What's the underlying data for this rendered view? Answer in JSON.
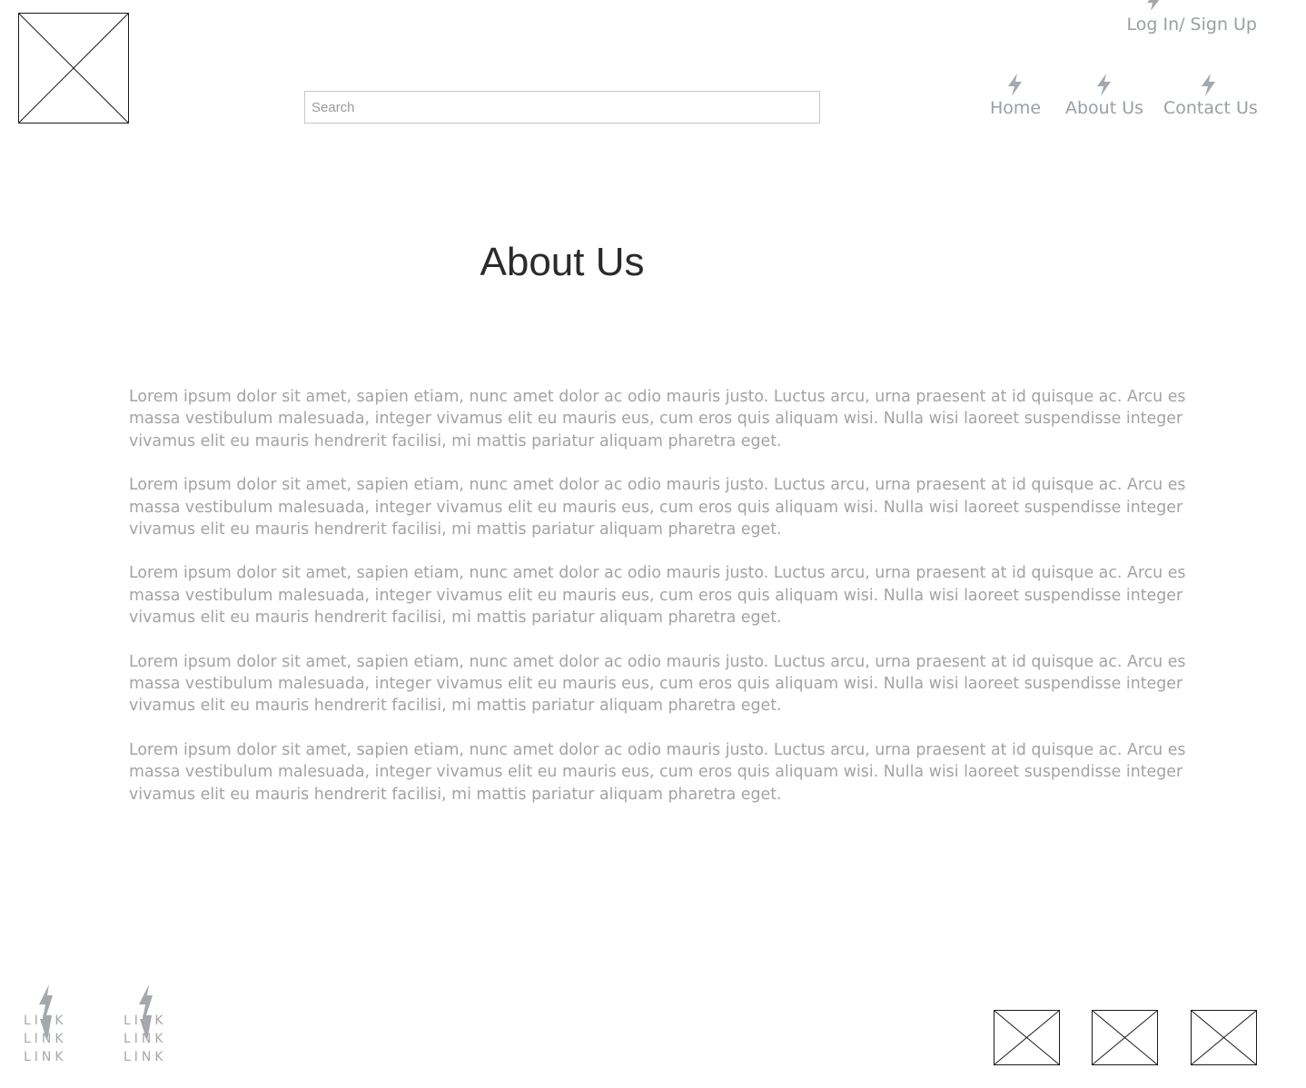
{
  "header": {
    "logo_icon": "image-placeholder-icon",
    "auth_link": "Log In/ Sign Up",
    "search": {
      "placeholder": "Search",
      "value": ""
    },
    "nav": [
      {
        "label": "Home",
        "icon": "bolt-icon"
      },
      {
        "label": "About Us",
        "icon": "bolt-icon"
      },
      {
        "label": "Contact Us",
        "icon": "bolt-icon"
      }
    ]
  },
  "main": {
    "title": "About Us",
    "paragraphs": [
      "Lorem ipsum dolor sit amet, sapien etiam, nunc amet dolor ac odio mauris justo. Luctus arcu, urna praesent at id quisque ac. Arcu es massa vestibulum malesuada, integer vivamus elit eu mauris eus, cum eros quis aliquam wisi. Nulla wisi laoreet suspendisse integer vivamus elit eu mauris hendrerit facilisi, mi mattis pariatur aliquam pharetra eget.",
      "Lorem ipsum dolor sit amet, sapien etiam, nunc amet dolor ac odio mauris justo. Luctus arcu, urna praesent at id quisque ac. Arcu es massa vestibulum malesuada, integer vivamus elit eu mauris eus, cum eros quis aliquam wisi. Nulla wisi laoreet suspendisse integer vivamus elit eu mauris hendrerit facilisi, mi mattis pariatur aliquam pharetra eget.",
      "Lorem ipsum dolor sit amet, sapien etiam, nunc amet dolor ac odio mauris justo. Luctus arcu, urna praesent at id quisque ac. Arcu es massa vestibulum malesuada, integer vivamus elit eu mauris eus, cum eros quis aliquam wisi. Nulla wisi laoreet suspendisse integer vivamus elit eu mauris hendrerit facilisi, mi mattis pariatur aliquam pharetra eget.",
      "Lorem ipsum dolor sit amet, sapien etiam, nunc amet dolor ac odio mauris justo. Luctus arcu, urna praesent at id quisque ac. Arcu es massa vestibulum malesuada, integer vivamus elit eu mauris eus, cum eros quis aliquam wisi. Nulla wisi laoreet suspendisse integer vivamus elit eu mauris hendrerit facilisi, mi mattis pariatur aliquam pharetra eget.",
      "Lorem ipsum dolor sit amet, sapien etiam, nunc amet dolor ac odio mauris justo. Luctus arcu, urna praesent at id quisque ac. Arcu es massa vestibulum malesuada, integer vivamus elit eu mauris eus, cum eros quis aliquam wisi. Nulla wisi laoreet suspendisse integer vivamus elit eu mauris hendrerit facilisi, mi mattis pariatur aliquam pharetra eget."
    ]
  },
  "footer": {
    "link_groups": [
      {
        "icon": "bolt-icon",
        "links": [
          "LINK",
          "LINK",
          "LINK"
        ]
      },
      {
        "icon": "bolt-icon",
        "links": [
          "LINK",
          "LINK",
          "LINK"
        ]
      }
    ],
    "social_placeholders": [
      "image-placeholder-icon",
      "image-placeholder-icon",
      "image-placeholder-icon"
    ]
  },
  "colors": {
    "text_muted": "#a3a3a3",
    "nav_text": "#9a9fa4",
    "title": "#2b2b2b",
    "placeholder_border": "#1a1a1a"
  }
}
